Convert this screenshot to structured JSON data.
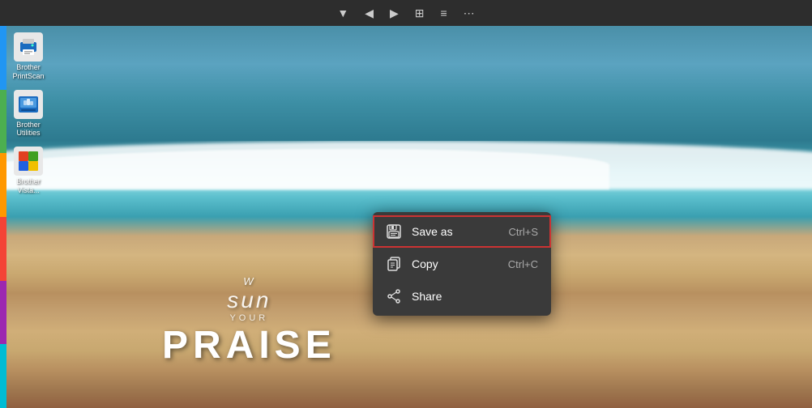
{
  "toolbar": {
    "icons": [
      "▼",
      "◀",
      "▶",
      "⊞",
      "≡"
    ]
  },
  "desktop_icons": [
    {
      "id": "icon-brother-print",
      "label": "Brother\nPrintScan",
      "color": "#1a6bbf",
      "symbol": "🖨"
    },
    {
      "id": "icon-brother-utilities",
      "label": "Brother\nUtilities",
      "color": "#1a6bbf",
      "symbol": "🔧"
    },
    {
      "id": "icon-brother-vista",
      "label": "Brother\nVista...",
      "color": "#e04020",
      "symbol": "🎨"
    }
  ],
  "beach_text": {
    "line1": "W",
    "line2": "sun",
    "line3": "YOUR",
    "line4": "PRAISE"
  },
  "context_menu": {
    "items": [
      {
        "id": "save-as",
        "label": "Save as",
        "shortcut": "Ctrl+S",
        "icon": "floppy",
        "highlighted": true
      },
      {
        "id": "copy",
        "label": "Copy",
        "shortcut": "Ctrl+C",
        "icon": "copy",
        "highlighted": false
      },
      {
        "id": "share",
        "label": "Share",
        "shortcut": "",
        "icon": "share",
        "highlighted": false
      }
    ]
  },
  "left_stripe": {
    "colors": [
      "#2196F3",
      "#4CAF50",
      "#FF9800",
      "#F44336",
      "#9C27B0",
      "#00BCD4"
    ]
  }
}
